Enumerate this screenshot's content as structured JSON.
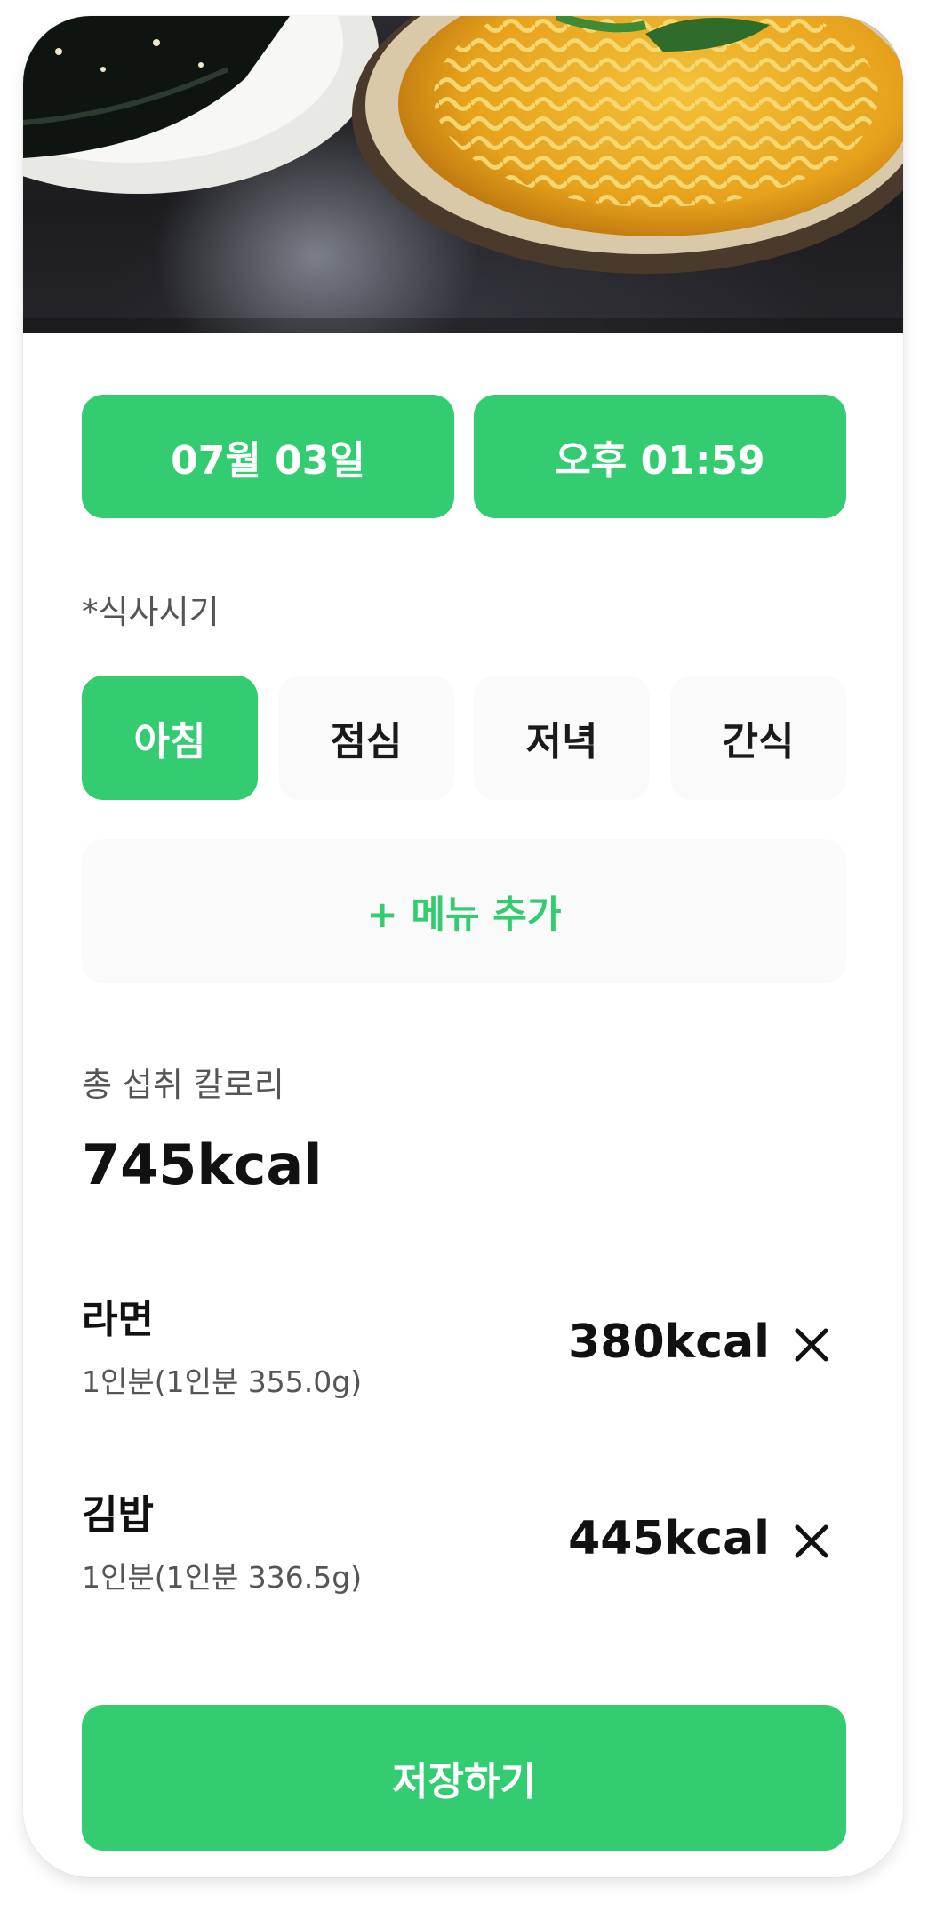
{
  "record": {
    "date_label": "07월 03일",
    "time_label": "오후 01:59"
  },
  "meal_time": {
    "label": "*식사시기",
    "options": [
      "아침",
      "점심",
      "저녁",
      "간식"
    ],
    "selected": "아침"
  },
  "add_menu_label": "+ 메뉴 추가",
  "total": {
    "label": "총 섭취 칼로리",
    "value": "745kcal"
  },
  "items": [
    {
      "name": "라면",
      "serving": "1인분(1인분 355.0g)",
      "kcal": "380kcal"
    },
    {
      "name": "김밥",
      "serving": "1인분(1인분 336.5g)",
      "kcal": "445kcal"
    }
  ],
  "save_label": "저장하기",
  "colors": {
    "accent": "#33cc70",
    "chip_bg": "#fafafa",
    "text_dark": "#111111",
    "text_muted": "#555555"
  },
  "icons": {
    "remove": "close-icon"
  }
}
